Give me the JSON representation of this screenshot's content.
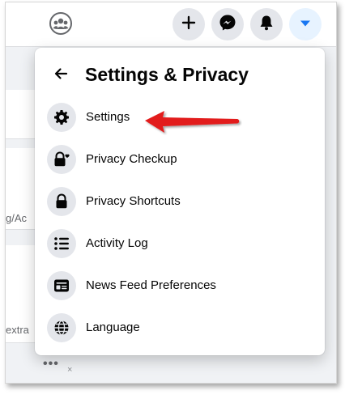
{
  "menu": {
    "title": "Settings & Privacy",
    "items": [
      {
        "label": "Settings",
        "icon": "gear-icon"
      },
      {
        "label": "Privacy Checkup",
        "icon": "lock-heart-icon"
      },
      {
        "label": "Privacy Shortcuts",
        "icon": "lock-icon"
      },
      {
        "label": "Activity Log",
        "icon": "list-icon"
      },
      {
        "label": "News Feed Preferences",
        "icon": "news-feed-icon"
      },
      {
        "label": "Language",
        "icon": "globe-icon"
      }
    ]
  },
  "background": {
    "clipped_text_1": "g/Ac",
    "clipped_text_2": "extra",
    "more": "•••",
    "close": "×"
  },
  "colors": {
    "accent": "#1877f2",
    "annotation_arrow": "#e21b1b",
    "icon_bg": "#e4e6eb"
  }
}
